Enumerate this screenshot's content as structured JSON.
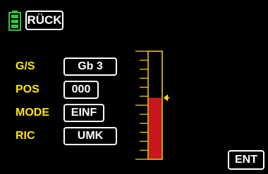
{
  "header": {
    "back_label": "RÜCK"
  },
  "rows": [
    {
      "label": "G/S",
      "value": "Gb 3"
    },
    {
      "label": "POS",
      "value": "000"
    },
    {
      "label": "MODE",
      "value": "EINF"
    },
    {
      "label": "RIC",
      "value": "UMK"
    }
  ],
  "footer": {
    "enter_label": "ENT"
  },
  "scale": {
    "fill_fraction": 0.57
  },
  "colors": {
    "label": "#ffe800",
    "battery": "#35c23a",
    "scale_frame": "#ffd800",
    "scale_fill": "#c8181e",
    "pointer": "#ffe800"
  }
}
